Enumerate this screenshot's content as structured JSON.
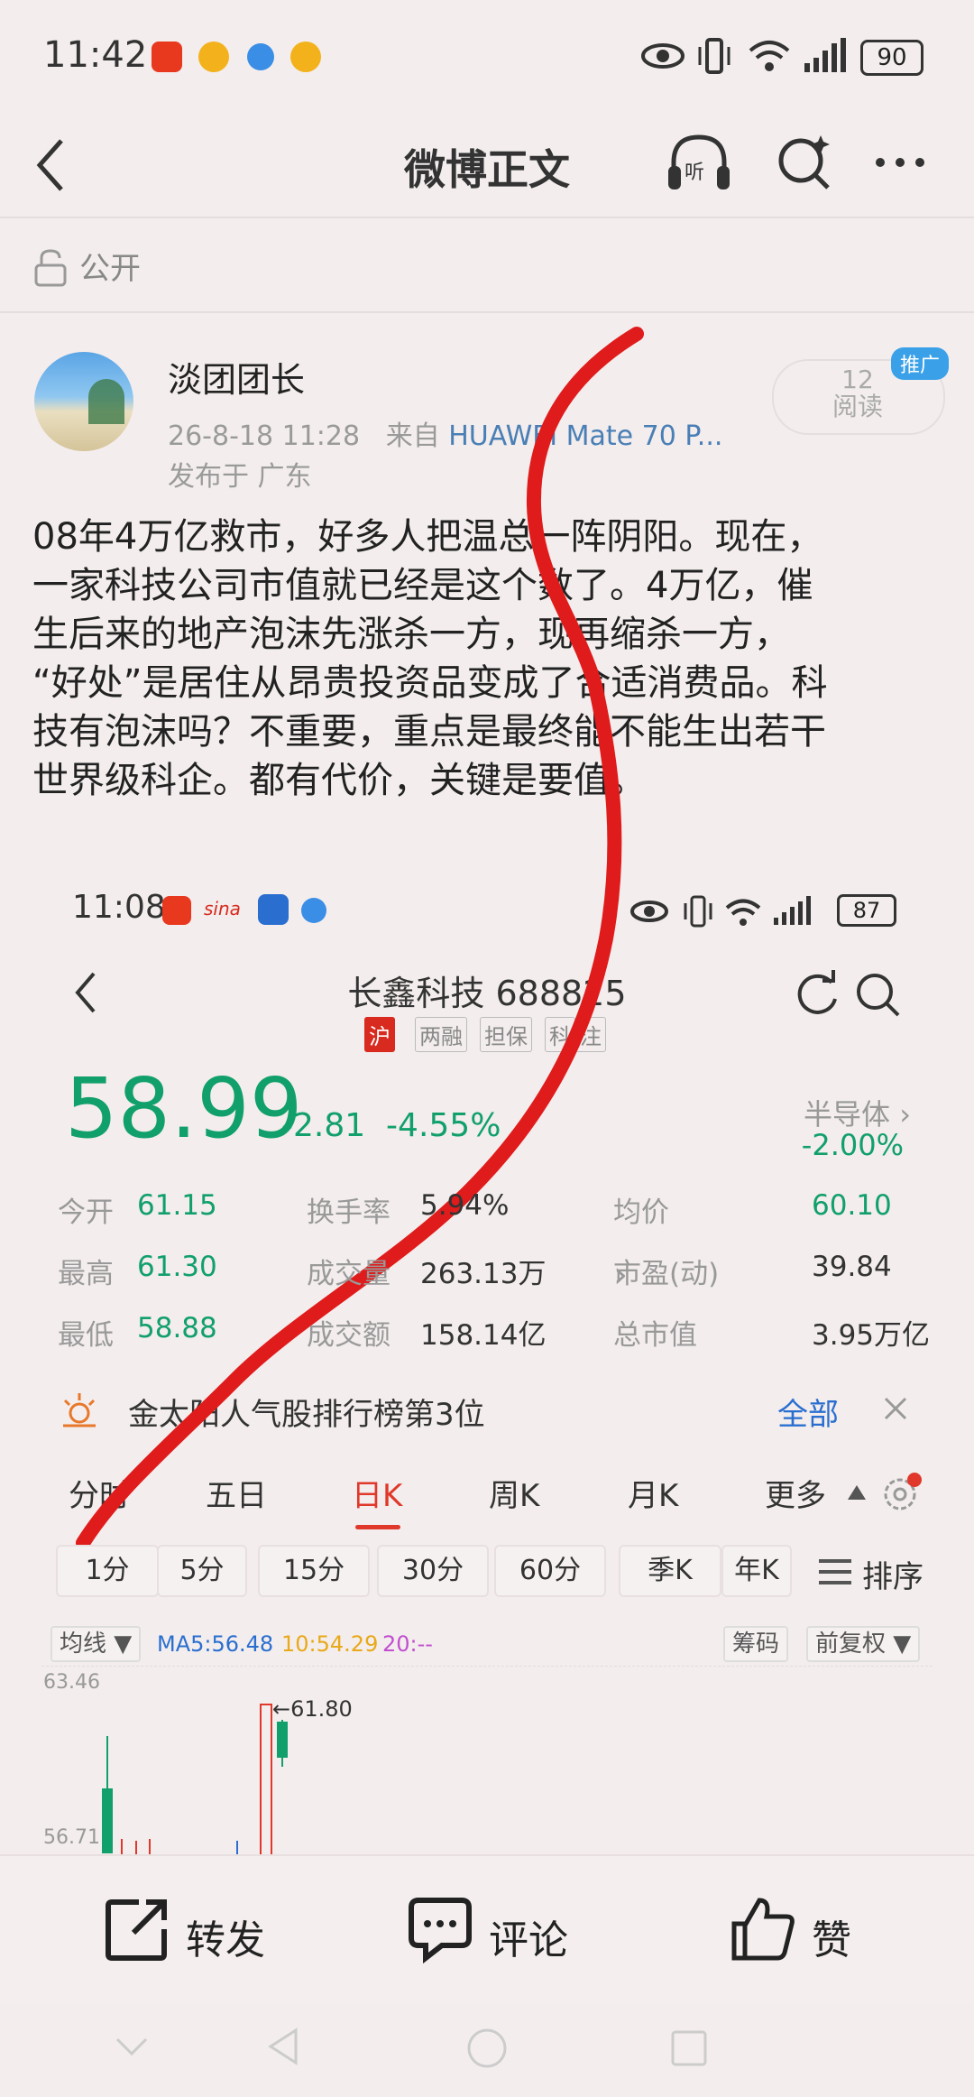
{
  "status_bar": {
    "time": "11:42",
    "battery": "90"
  },
  "header": {
    "title": "微博正文"
  },
  "visibility": {
    "label": "公开"
  },
  "post": {
    "author": "淡团团长",
    "date": "26-8-18 11:28",
    "from_prefix": "来自",
    "device": "HUAWEI Mate 70 P...",
    "location": "发布于 广东",
    "read_count": "12",
    "read_label": "阅读",
    "ad_badge": "推广",
    "lines": [
      "08年4万亿救市，好多人把温总一阵阴阳。现在，",
      "一家科技公司市值就已经是这个数了。4万亿，催",
      "生后来的地产泡沫先涨杀一方，现再缩杀一方，",
      "“好处”是居住从昂贵投资品变成了合适消费品。科",
      "技有泡沫吗？不重要，重点是最终能不能生出若干",
      "世界级科企。都有代价，关键是要值。"
    ]
  },
  "screenshot": {
    "time": "11:08",
    "battery": "87",
    "stock_name": "长鑫科技 688825",
    "tags": [
      "沪",
      "两融",
      "担保",
      "科",
      "注"
    ],
    "price": "58.99",
    "change": "-2.81",
    "change_pct": "-4.55%",
    "sector": "半导体",
    "sector_chg": "-2.00%",
    "stats": [
      {
        "label": "今开",
        "value": "61.15",
        "green": true
      },
      {
        "label": "换手率",
        "value": "5.94%",
        "green": false
      },
      {
        "label": "均价",
        "value": "60.10",
        "green": true
      },
      {
        "label": "最高",
        "value": "61.30",
        "green": true
      },
      {
        "label": "成交量",
        "value": "263.13万",
        "green": false
      },
      {
        "label": "市盈(动)",
        "value": "39.84",
        "green": false
      },
      {
        "label": "最低",
        "value": "58.88",
        "green": true
      },
      {
        "label": "成交额",
        "value": "158.14亿",
        "green": false
      },
      {
        "label": "总市值",
        "value": "3.95万亿",
        "green": false
      }
    ],
    "banner_text": "金太阳人气股排行榜第3位",
    "banner_all": "全部",
    "tabs": [
      "分时",
      "五日",
      "日K",
      "周K",
      "月K",
      "更多"
    ],
    "active_tab": "日K",
    "periods": [
      "1分",
      "5分",
      "15分",
      "30分",
      "60分",
      "季K",
      "年K"
    ],
    "sort_label": "排序",
    "ma_select": "均线",
    "ma5": "MA5:56.48",
    "ma10": "10:54.29",
    "ma20": "20:--",
    "chips_label": "筹码",
    "adjust_label": "前复权",
    "y_high": "63.46",
    "y_low": "56.71",
    "peak_label": "←61.80",
    "colors": {
      "up": "#e0382a",
      "down": "#11a06b"
    }
  },
  "actions": {
    "repost": "转发",
    "comment": "评论",
    "like": "赞"
  }
}
